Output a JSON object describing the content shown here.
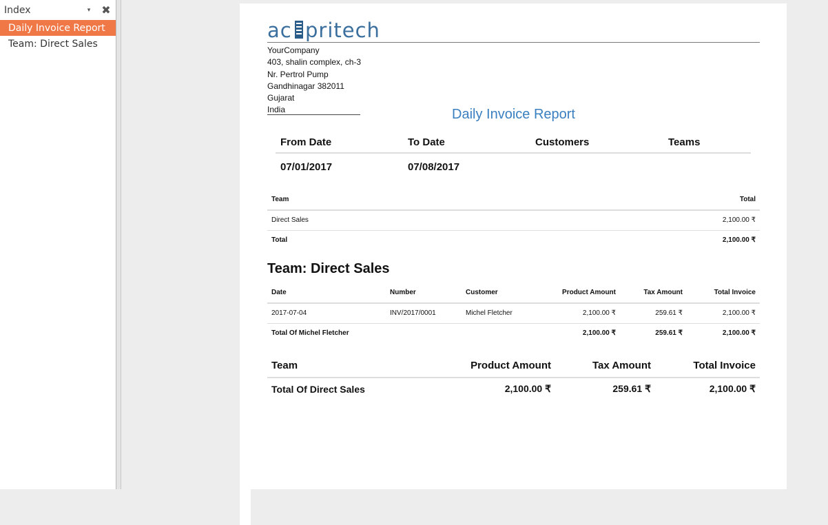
{
  "sidebar": {
    "title": "Index",
    "dropdown_glyph": "▾",
    "close_glyph": "✖",
    "items": [
      {
        "label": "Daily Invoice Report",
        "page": "1"
      },
      {
        "label": "Team: Direct Sales",
        "page": "1"
      }
    ]
  },
  "logo": {
    "text_before": "ac",
    "text_after": "pritech"
  },
  "company": {
    "name": "YourCompany",
    "street": "403, shalin complex, ch-3",
    "street2": "Nr. Pertrol Pump",
    "city_zip": "Gandhinagar 382011",
    "state": "Gujarat",
    "country": "India"
  },
  "report": {
    "title": "Daily Invoice Report",
    "filters": {
      "headers": [
        "From Date",
        "To Date",
        "Customers",
        "Teams"
      ],
      "values": [
        "07/01/2017",
        "07/08/2017",
        "",
        ""
      ]
    }
  },
  "summary": {
    "headers": [
      "Team",
      "Total"
    ],
    "rows": [
      {
        "team": "Direct Sales",
        "total": "2,100.00 ₹"
      }
    ],
    "total_label": "Total",
    "total_value": "2,100.00 ₹"
  },
  "team_section": {
    "title": "Team: Direct Sales",
    "headers": [
      "Date",
      "Number",
      "Customer",
      "Product Amount",
      "Tax Amount",
      "Total Invoice"
    ],
    "rows": [
      {
        "date": "2017-07-04",
        "number": "INV/2017/0001",
        "customer": "Michel Fletcher",
        "product": "2,100.00 ₹",
        "tax": "259.61 ₹",
        "total": "2,100.00 ₹"
      }
    ],
    "subtotal": {
      "label": "Total Of Michel Fletcher",
      "product": "2,100.00 ₹",
      "tax": "259.61 ₹",
      "total": "2,100.00 ₹"
    }
  },
  "team_total": {
    "headers": [
      "Team",
      "Product Amount",
      "Tax Amount",
      "Total Invoice"
    ],
    "label": "Total Of Direct Sales",
    "product": "2,100.00 ₹",
    "tax": "259.61 ₹",
    "total": "2,100.00 ₹"
  },
  "colors": {
    "accent": "#f07746",
    "title_blue": "#3a7fbf",
    "logo_blue": "#2a5d8a"
  }
}
